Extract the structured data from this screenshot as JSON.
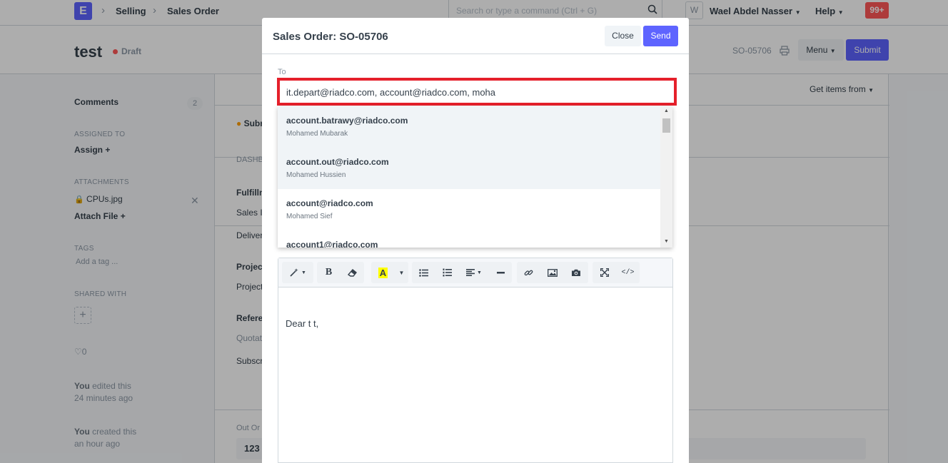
{
  "navbar": {
    "breadcrumbs": [
      "Selling",
      "Sales Order"
    ],
    "logo_letter": "E",
    "search_placeholder": "Search or type a command (Ctrl + G)",
    "avatar_letter": "W",
    "user_name": "Wael Abdel Nasser",
    "help": "Help",
    "notifications": "99+"
  },
  "page": {
    "title": "test",
    "status": "Draft",
    "doc_id": "SO-05706",
    "menu": "Menu",
    "submit": "Submit"
  },
  "sidebar": {
    "comments": "Comments",
    "comments_count": "2",
    "assigned_to_label": "ASSIGNED TO",
    "assign": "Assign",
    "attachments_label": "ATTACHMENTS",
    "attachment_file": "CPUs.jpg",
    "attach_file": "Attach File",
    "tags_label": "TAGS",
    "add_tag": "Add a tag ...",
    "shared_with_label": "SHARED WITH",
    "likes": "0",
    "activity": [
      {
        "who": "You",
        "action": " edited this",
        "when": "24 minutes ago"
      },
      {
        "who": "You",
        "action": " created this",
        "when": "an hour ago"
      }
    ]
  },
  "main": {
    "get_items": "Get items from",
    "fragments": {
      "subm": "Subm",
      "dashb": "DASHB",
      "fulfillm": "Fulfillm",
      "sales_in": "Sales In",
      "deliver": "Deliver",
      "project_h": "Project",
      "project": "Project",
      "refere": "Refere",
      "quotat": "Quotat",
      "subscr": "Subscr",
      "out_or": "Out Or",
      "out_val": "123"
    }
  },
  "modal": {
    "title": "Sales Order: SO-05706",
    "close": "Close",
    "send": "Send",
    "to_label": "To",
    "to_value": "it.depart@riadco.com, account@riadco.com, moha",
    "suggestions": [
      {
        "email": "account.batrawy@riadco.com",
        "name": "Mohamed Mubarak"
      },
      {
        "email": "account.out@riadco.com",
        "name": "Mohamed Hussien"
      },
      {
        "email": "account@riadco.com",
        "name": "Mohamed Sief"
      },
      {
        "email": "account1@riadco.com",
        "name": ""
      }
    ],
    "editor_text": "Dear t t,"
  },
  "colors": {
    "primary": "#5e64ff",
    "highlight_border": "#e5202b",
    "draft_dot": "#ff5858",
    "notif_badge": "#ff5858",
    "text_highlight_yellow": "#ffff00"
  },
  "icons": [
    "chevron-right-icon",
    "search-icon",
    "caret-down-icon",
    "print-icon",
    "plus-icon",
    "lock-icon",
    "close-icon",
    "heart-icon",
    "magic-wand-icon",
    "bold-icon",
    "eraser-icon",
    "font-color-icon",
    "unordered-list-icon",
    "ordered-list-icon",
    "align-icon",
    "horizontal-rule-icon",
    "link-icon",
    "image-icon",
    "camera-icon",
    "fullscreen-icon",
    "code-view-icon"
  ]
}
